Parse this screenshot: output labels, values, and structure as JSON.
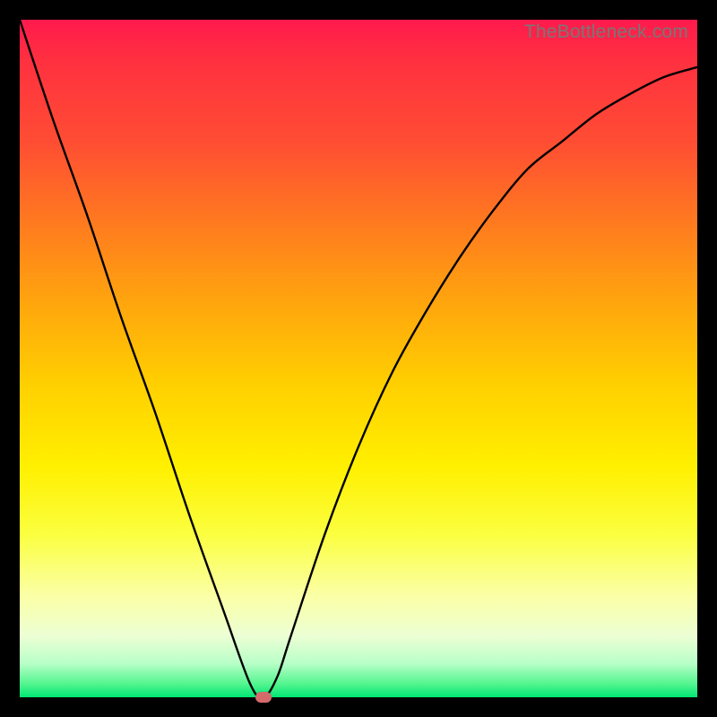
{
  "watermark": "TheBottleneck.com",
  "colors": {
    "frame": "#000000",
    "curve": "#000000",
    "marker": "#d56a6a"
  },
  "chart_data": {
    "type": "line",
    "title": "",
    "xlabel": "",
    "ylabel": "",
    "xlim": [
      0,
      100
    ],
    "ylim": [
      0,
      100
    ],
    "grid": false,
    "legend": false,
    "series": [
      {
        "name": "bottleneck-curve",
        "x": [
          0,
          5,
          10,
          15,
          20,
          25,
          30,
          34,
          36,
          38,
          40,
          45,
          50,
          55,
          60,
          65,
          70,
          75,
          80,
          85,
          90,
          95,
          100
        ],
        "y": [
          100,
          85,
          71,
          56,
          42,
          27,
          13,
          2,
          0,
          3,
          9,
          24,
          37,
          48,
          57,
          65,
          72,
          78,
          82,
          86,
          89,
          91.5,
          93
        ]
      }
    ],
    "annotations": [
      {
        "name": "minimum-marker",
        "x": 36,
        "y": 0
      }
    ],
    "background_gradient": {
      "top": "#ff1a4d",
      "bottom": "#00e673",
      "direction": "vertical"
    }
  }
}
